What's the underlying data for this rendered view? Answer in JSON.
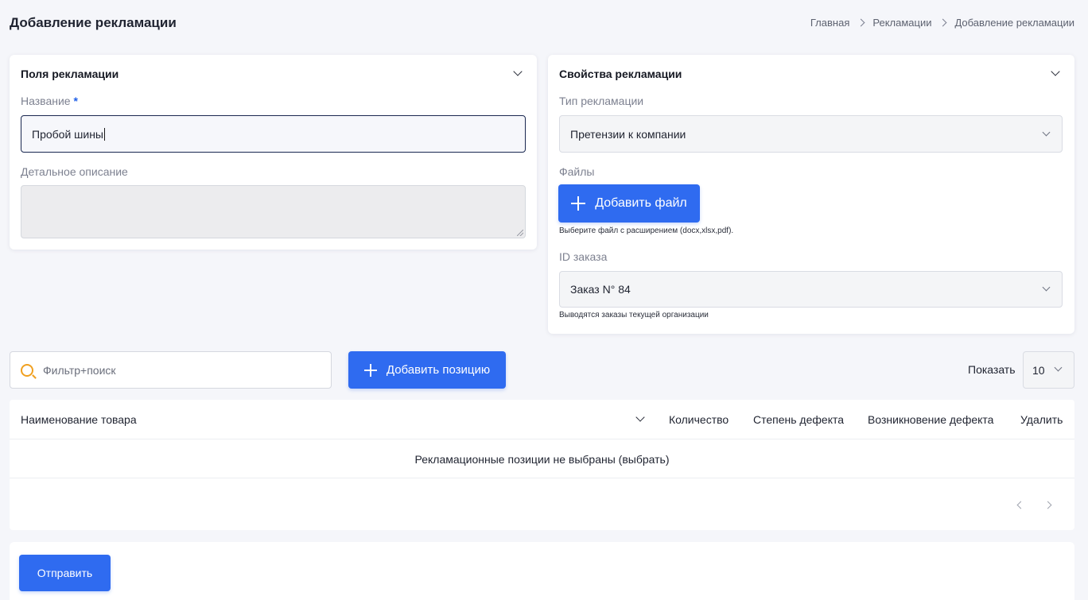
{
  "page": {
    "title": "Добавление рекламации",
    "breadcrumb": [
      "Главная",
      "Рекламации",
      "Добавление рекламации"
    ]
  },
  "fields_card": {
    "title": "Поля рекламации",
    "name_label": "Название",
    "name_required_mark": "*",
    "name_value": "Пробой шины",
    "description_label": "Детальное описание",
    "description_value": ""
  },
  "props_card": {
    "title": "Свойства рекламации",
    "type_label": "Тип рекламации",
    "type_value": "Претензии к компании",
    "files_label": "Файлы",
    "add_file_button": "Добавить файл",
    "files_hint": "Выберите файл с расширением (docx,xlsx,pdf).",
    "order_label": "ID заказа",
    "order_value": "Заказ N° 84",
    "order_hint": "Выводятся заказы текущей организации"
  },
  "toolbar": {
    "search_placeholder": "Фильтр+поиск",
    "add_position_button": "Добавить позицию",
    "show_label": "Показать",
    "page_size_value": "10"
  },
  "table": {
    "columns": [
      "Наименование товара",
      "Количество",
      "Степень дефекта",
      "Возникновение дефекта",
      "Удалить"
    ],
    "empty_message": "Рекламационные позиции не выбраны (выбрать)"
  },
  "footer": {
    "submit_button": "Отправить"
  },
  "colors": {
    "accent": "#2f6bf0",
    "search_icon": "#f0a020",
    "background": "#f5f6fa"
  }
}
